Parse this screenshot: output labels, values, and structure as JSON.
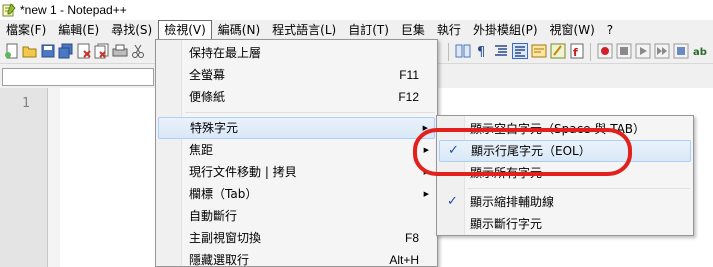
{
  "window": {
    "title": "*new 1 - Notepad++"
  },
  "menubar": [
    {
      "label": "檔案(F)"
    },
    {
      "label": "編輯(E)"
    },
    {
      "label": "尋找(S)"
    },
    {
      "label": "檢視(V)",
      "active": true
    },
    {
      "label": "編碼(N)"
    },
    {
      "label": "程式語言(L)"
    },
    {
      "label": "自訂(T)"
    },
    {
      "label": "巨集"
    },
    {
      "label": "執行"
    },
    {
      "label": "外掛模組(P)"
    },
    {
      "label": "視窗(W)"
    },
    {
      "label": "?"
    }
  ],
  "editor": {
    "line_number": "1"
  },
  "view_menu": {
    "items": [
      {
        "label": "保持在最上層",
        "shortcut": ""
      },
      {
        "label": "全螢幕",
        "shortcut": "F11"
      },
      {
        "label": "便條紙",
        "shortcut": "F12"
      },
      {
        "label": "特殊字元",
        "shortcut": "",
        "submenu": true,
        "highlighted": true
      },
      {
        "label": "焦距",
        "shortcut": "",
        "submenu": true
      },
      {
        "label": "現行文件移動 | 拷貝",
        "shortcut": "",
        "submenu": true
      },
      {
        "label": "欄標（Tab）",
        "shortcut": "",
        "submenu": true
      },
      {
        "label": "自動斷行",
        "shortcut": ""
      },
      {
        "label": "主副視窗切換",
        "shortcut": "F8"
      },
      {
        "label": "隱藏選取行",
        "shortcut": "Alt+H"
      }
    ]
  },
  "special_chars_submenu": {
    "items": [
      {
        "label": "顯示空白字元（Space 與 TAB）",
        "checked": false
      },
      {
        "label": "顯示行尾字元（EOL）",
        "checked": true,
        "highlighted": true
      },
      {
        "label": "顯示所有字元",
        "checked": false
      },
      {
        "label": "顯示縮排輔助線",
        "checked": true
      },
      {
        "label": "顯示斷行字元",
        "checked": false
      }
    ],
    "check_glyph": "✓"
  },
  "colors": {
    "annotation": "#e2201c",
    "menu_highlight": "#d9e8f7",
    "check": "#2050a8"
  }
}
